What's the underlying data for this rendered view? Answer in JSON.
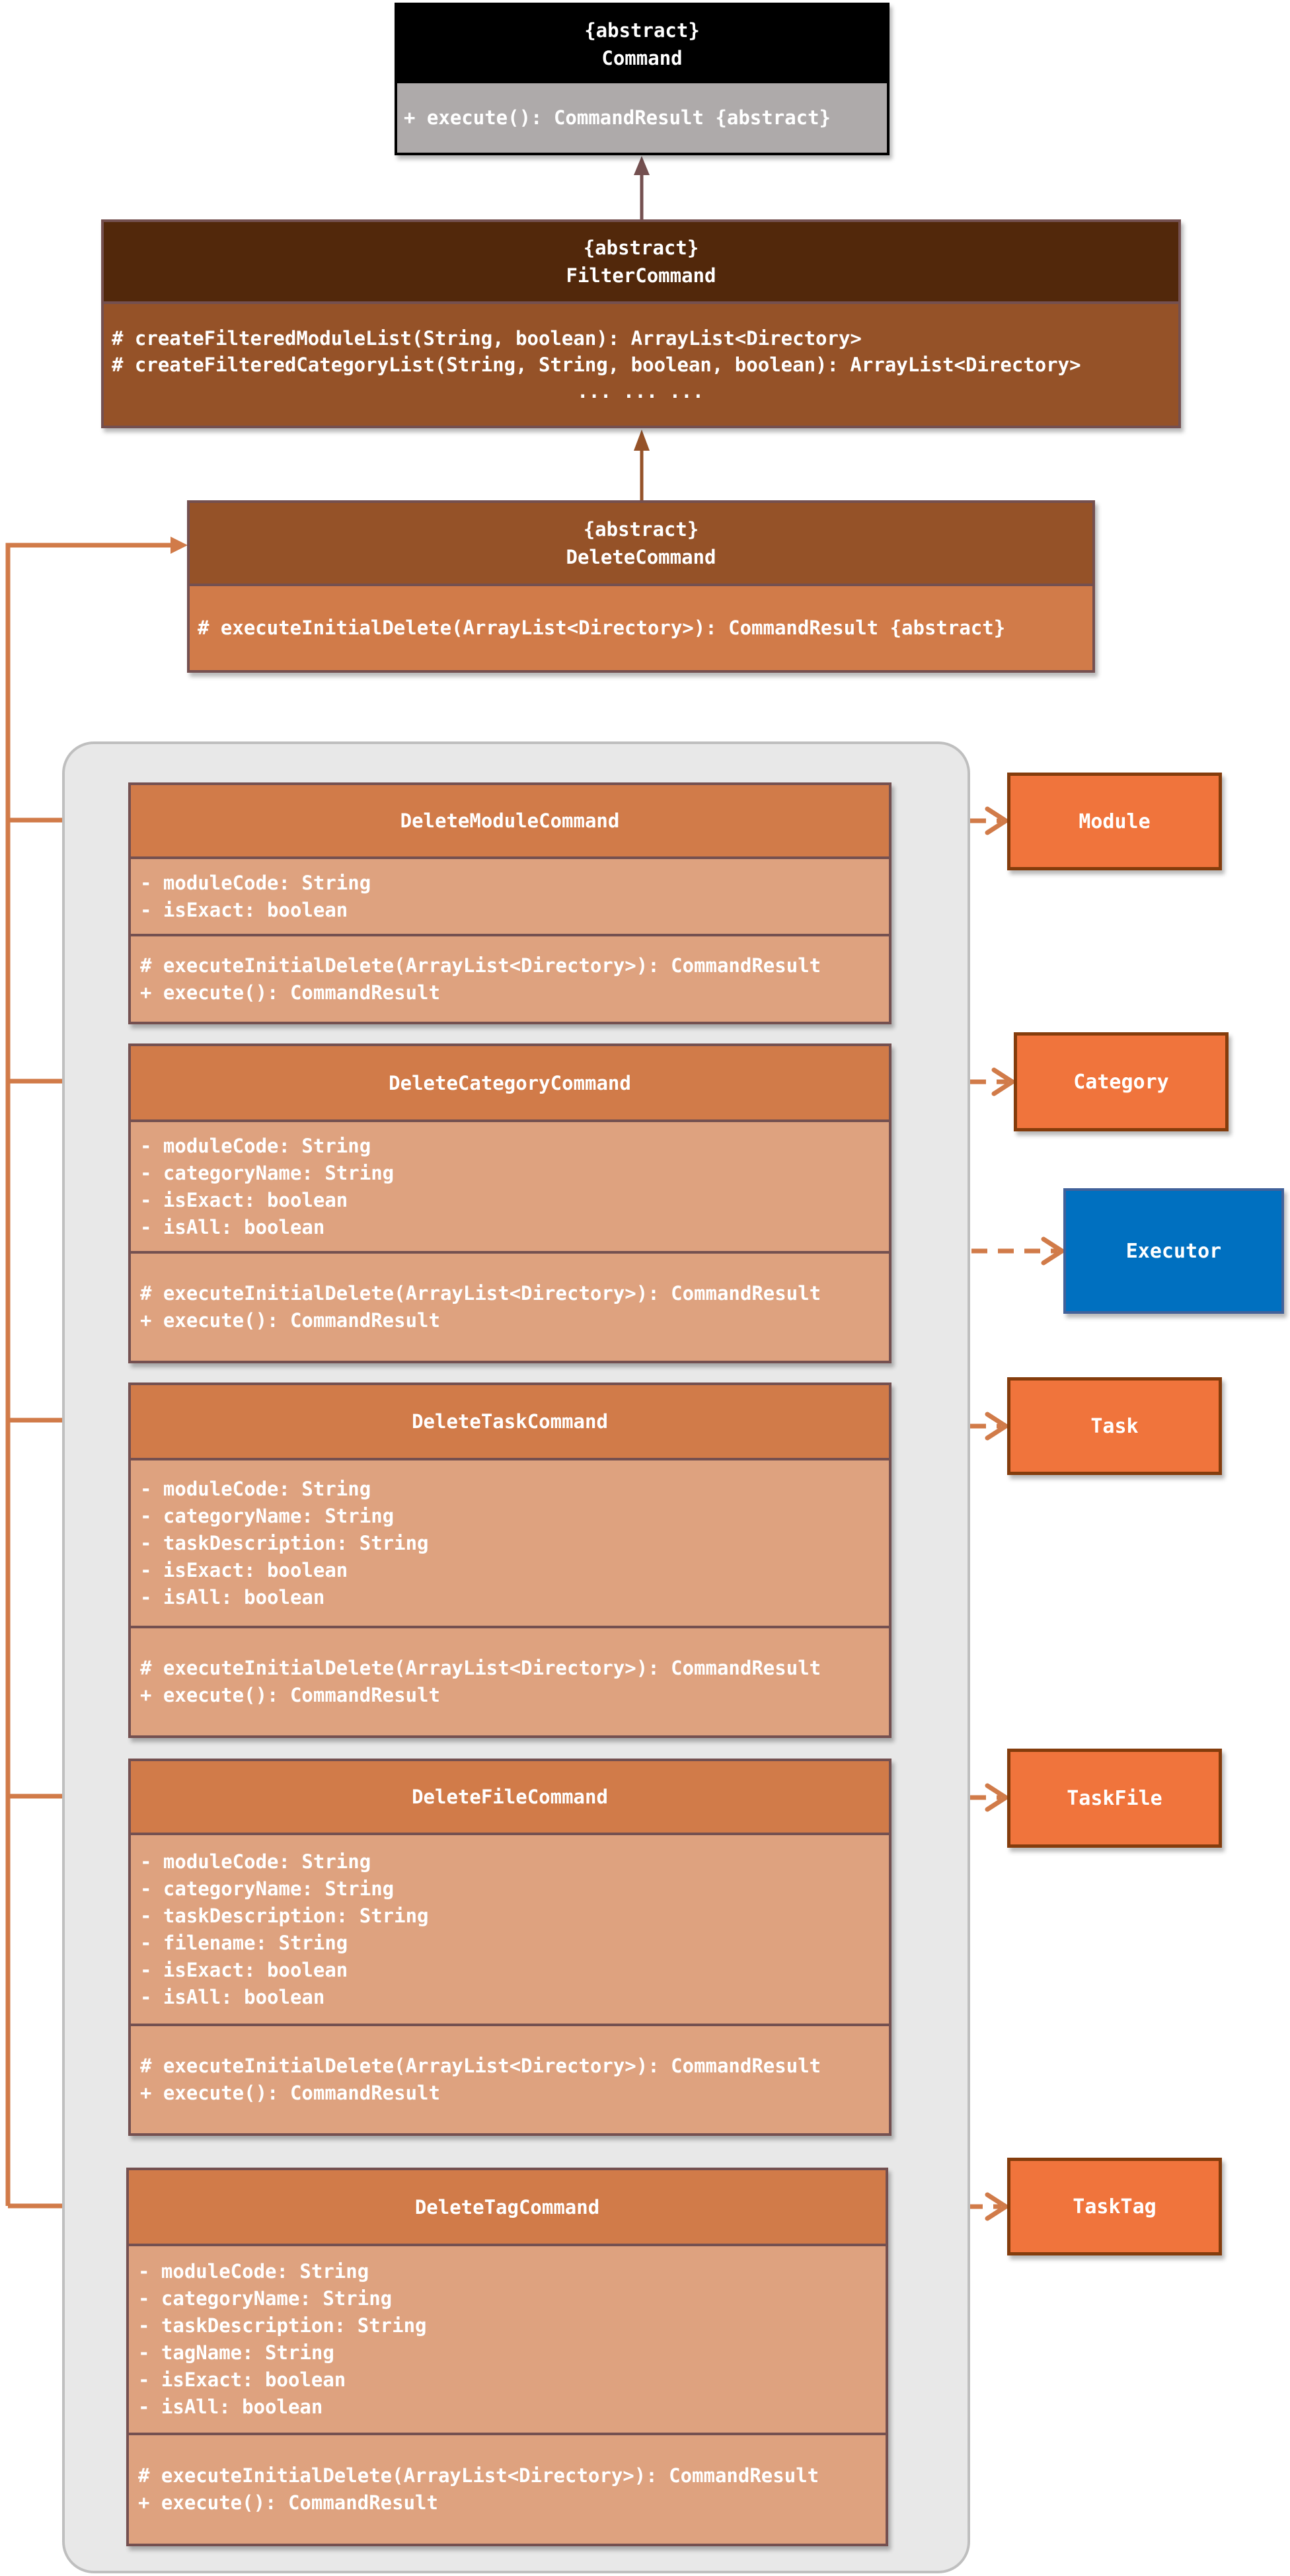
{
  "diagram": {
    "type": "UML class diagram",
    "classes": {
      "command": {
        "stereotype": "{abstract}",
        "name": "Command",
        "methods": [
          "+ execute(): CommandResult {abstract}"
        ]
      },
      "filter_command": {
        "stereotype": "{abstract}",
        "name": "FilterCommand",
        "methods": [
          "# createFilteredModuleList(String, boolean): ArrayList<Directory>",
          "# createFilteredCategoryList(String, String, boolean, boolean): ArrayList<Directory>",
          "... ... ..."
        ]
      },
      "delete_command": {
        "stereotype": "{abstract}",
        "name": "DeleteCommand",
        "methods": [
          "# executeInitialDelete(ArrayList<Directory>): CommandResult {abstract}"
        ]
      },
      "delete_module_command": {
        "name": "DeleteModuleCommand",
        "attributes": [
          "- moduleCode: String",
          "- isExact: boolean"
        ],
        "methods": [
          "# executeInitialDelete(ArrayList<Directory>): CommandResult",
          "+ execute(): CommandResult"
        ]
      },
      "delete_category_command": {
        "name": "DeleteCategoryCommand",
        "attributes": [
          "- moduleCode: String",
          "- categoryName: String",
          "- isExact: boolean",
          "- isAll: boolean"
        ],
        "methods": [
          "# executeInitialDelete(ArrayList<Directory>): CommandResult",
          "+ execute(): CommandResult"
        ]
      },
      "delete_task_command": {
        "name": "DeleteTaskCommand",
        "attributes": [
          "- moduleCode: String",
          "- categoryName: String",
          "- taskDescription: String",
          "- isExact: boolean",
          "- isAll: boolean"
        ],
        "methods": [
          "# executeInitialDelete(ArrayList<Directory>): CommandResult",
          "+ execute(): CommandResult"
        ]
      },
      "delete_file_command": {
        "name": "DeleteFileCommand",
        "attributes": [
          "- moduleCode: String",
          "- categoryName: String",
          "- taskDescription: String",
          "- filename: String",
          "- isExact: boolean",
          "- isAll: boolean"
        ],
        "methods": [
          "# executeInitialDelete(ArrayList<Directory>): CommandResult",
          "+ execute(): CommandResult"
        ]
      },
      "delete_tag_command": {
        "name": "DeleteTagCommand",
        "attributes": [
          "- moduleCode: String",
          "- categoryName: String",
          "- taskDescription: String",
          "- tagName: String",
          "- isExact: boolean",
          "- isAll: boolean"
        ],
        "methods": [
          "# executeInitialDelete(ArrayList<Directory>): CommandResult",
          "+ execute(): CommandResult"
        ]
      }
    },
    "dependencies": {
      "module": "Module",
      "category": "Category",
      "executor": "Executor",
      "task": "Task",
      "task_file": "TaskFile",
      "task_tag": "TaskTag"
    },
    "relationships": [
      {
        "from": "FilterCommand",
        "to": "Command",
        "kind": "inheritance"
      },
      {
        "from": "DeleteCommand",
        "to": "FilterCommand",
        "kind": "inheritance"
      },
      {
        "from": "DeleteModuleCommand",
        "to": "DeleteCommand",
        "kind": "inheritance"
      },
      {
        "from": "DeleteCategoryCommand",
        "to": "DeleteCommand",
        "kind": "inheritance"
      },
      {
        "from": "DeleteTaskCommand",
        "to": "DeleteCommand",
        "kind": "inheritance"
      },
      {
        "from": "DeleteFileCommand",
        "to": "DeleteCommand",
        "kind": "inheritance"
      },
      {
        "from": "DeleteTagCommand",
        "to": "DeleteCommand",
        "kind": "inheritance"
      },
      {
        "from": "DeleteModuleCommand",
        "to": "Module",
        "kind": "dependency"
      },
      {
        "from": "DeleteCategoryCommand",
        "to": "Category",
        "kind": "dependency"
      },
      {
        "from": "DeleteCommand subclasses",
        "to": "Executor",
        "kind": "dependency"
      },
      {
        "from": "DeleteTaskCommand",
        "to": "Task",
        "kind": "dependency"
      },
      {
        "from": "DeleteFileCommand",
        "to": "TaskFile",
        "kind": "dependency"
      },
      {
        "from": "DeleteTagCommand",
        "to": "TaskTag",
        "kind": "dependency"
      }
    ],
    "colors": {
      "command_header": "#000000",
      "command_body": "#aeaaaa",
      "filter_header": "#52280b",
      "filter_body": "#955228",
      "delete_header": "#955228",
      "delete_body": "#d17b49",
      "sub_header": "#d17b49",
      "sub_body": "#dea27f",
      "box_border": "#745050",
      "entity_fill": "#f0743c",
      "entity_border": "#843c0c",
      "executor_fill": "#0070c0",
      "executor_border": "#41619a",
      "arrow_inherit_top": "#745050",
      "arrow_orange": "#d17b49",
      "container_fill": "#e8e8e8",
      "container_border": "#bfbfbf"
    }
  }
}
